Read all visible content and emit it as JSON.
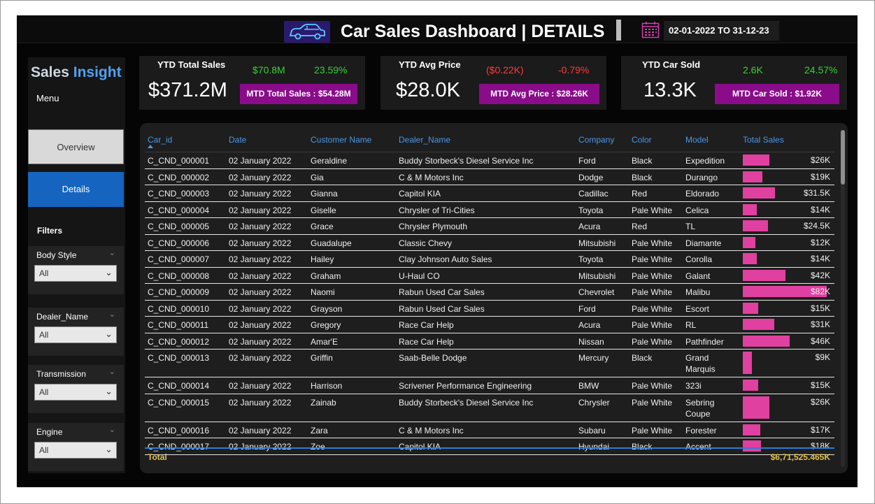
{
  "header": {
    "title": "Car Sales Dashboard | DETAILS",
    "date_range": "02-01-2022 TO 31-12-23"
  },
  "sidebar": {
    "brand_part1": "Sales",
    "brand_part2": "Insight",
    "menu_label": "Menu",
    "nav": [
      {
        "label": "Overview"
      },
      {
        "label": "Details"
      }
    ],
    "filters_label": "Filters",
    "filters": [
      {
        "title": "Body Style",
        "value": "All"
      },
      {
        "title": "Dealer_Name",
        "value": "All"
      },
      {
        "title": "Transmission",
        "value": "All"
      },
      {
        "title": "Engine",
        "value": "All"
      }
    ]
  },
  "kpis": [
    {
      "title": "YTD Total Sales",
      "value": "$371.2M",
      "delta_value": "$70.8M",
      "delta_pct": "23.59%",
      "mtd": "MTD Total Sales : $54.28M"
    },
    {
      "title": "YTD Avg Price",
      "value": "$28.0K",
      "delta_value": "($0.22K)",
      "delta_pct": "-0.79%",
      "mtd": "MTD Avg Price : $28.26K"
    },
    {
      "title": "YTD Car Sold",
      "value": "13.3K",
      "delta_value": "2.6K",
      "delta_pct": "24.57%",
      "mtd": "MTD Car Sold : $1.92K"
    }
  ],
  "table": {
    "columns": [
      "Car_id",
      "Date",
      "Customer Name",
      "Dealer_Name",
      "Company",
      "Color",
      "Model",
      "Total Sales"
    ],
    "rows": [
      {
        "car_id": "C_CND_000001",
        "date": "02 January 2022",
        "customer": "Geraldine",
        "dealer": "Buddy Storbeck's Diesel Service Inc",
        "company": "Ford",
        "color": "Black",
        "model": "Expedition",
        "model2": "",
        "sales": "$26K",
        "sales_value": 26
      },
      {
        "car_id": "C_CND_000002",
        "date": "02 January 2022",
        "customer": "Gia",
        "dealer": "C & M Motors Inc",
        "company": "Dodge",
        "color": "Black",
        "model": "Durango",
        "model2": "",
        "sales": "$19K",
        "sales_value": 19
      },
      {
        "car_id": "C_CND_000003",
        "date": "02 January 2022",
        "customer": "Gianna",
        "dealer": "Capitol KIA",
        "company": "Cadillac",
        "color": "Red",
        "model": "Eldorado",
        "model2": "",
        "sales": "$31.5K",
        "sales_value": 31.5
      },
      {
        "car_id": "C_CND_000004",
        "date": "02 January 2022",
        "customer": "Giselle",
        "dealer": "Chrysler of Tri-Cities",
        "company": "Toyota",
        "color": "Pale White",
        "model": "Celica",
        "model2": "",
        "sales": "$14K",
        "sales_value": 14
      },
      {
        "car_id": "C_CND_000005",
        "date": "02 January 2022",
        "customer": "Grace",
        "dealer": "Chrysler Plymouth",
        "company": "Acura",
        "color": "Red",
        "model": "TL",
        "model2": "",
        "sales": "$24.5K",
        "sales_value": 24.5
      },
      {
        "car_id": "C_CND_000006",
        "date": "02 January 2022",
        "customer": "Guadalupe",
        "dealer": "Classic Chevy",
        "company": "Mitsubishi",
        "color": "Pale White",
        "model": "Diamante",
        "model2": "",
        "sales": "$12K",
        "sales_value": 12
      },
      {
        "car_id": "C_CND_000007",
        "date": "02 January 2022",
        "customer": "Hailey",
        "dealer": "Clay Johnson Auto Sales",
        "company": "Toyota",
        "color": "Pale White",
        "model": "Corolla",
        "model2": "",
        "sales": "$14K",
        "sales_value": 14
      },
      {
        "car_id": "C_CND_000008",
        "date": "02 January 2022",
        "customer": "Graham",
        "dealer": "U-Haul CO",
        "company": "Mitsubishi",
        "color": "Pale White",
        "model": "Galant",
        "model2": "",
        "sales": "$42K",
        "sales_value": 42
      },
      {
        "car_id": "C_CND_000009",
        "date": "02 January 2022",
        "customer": "Naomi",
        "dealer": "Rabun Used Car Sales",
        "company": "Chevrolet",
        "color": "Pale White",
        "model": "Malibu",
        "model2": "",
        "sales": "$82K",
        "sales_value": 82
      },
      {
        "car_id": "C_CND_000010",
        "date": "02 January 2022",
        "customer": "Grayson",
        "dealer": "Rabun Used Car Sales",
        "company": "Ford",
        "color": "Pale White",
        "model": "Escort",
        "model2": "",
        "sales": "$15K",
        "sales_value": 15
      },
      {
        "car_id": "C_CND_000011",
        "date": "02 January 2022",
        "customer": "Gregory",
        "dealer": "Race Car Help",
        "company": "Acura",
        "color": "Pale White",
        "model": "RL",
        "model2": "",
        "sales": "$31K",
        "sales_value": 31
      },
      {
        "car_id": "C_CND_000012",
        "date": "02 January 2022",
        "customer": "Amar'E",
        "dealer": "Race Car Help",
        "company": "Nissan",
        "color": "Pale White",
        "model": "Pathfinder",
        "model2": "",
        "sales": "$46K",
        "sales_value": 46
      },
      {
        "car_id": "C_CND_000013",
        "date": "02 January 2022",
        "customer": "Griffin",
        "dealer": "Saab-Belle Dodge",
        "company": "Mercury",
        "color": "Black",
        "model": "Grand",
        "model2": "Marquis",
        "sales": "$9K",
        "sales_value": 9
      },
      {
        "car_id": "C_CND_000014",
        "date": "02 January 2022",
        "customer": "Harrison",
        "dealer": "Scrivener Performance Engineering",
        "company": "BMW",
        "color": "Pale White",
        "model": "323i",
        "model2": "",
        "sales": "$15K",
        "sales_value": 15
      },
      {
        "car_id": "C_CND_000015",
        "date": "02 January 2022",
        "customer": "Zainab",
        "dealer": "Buddy Storbeck's Diesel Service Inc",
        "company": "Chrysler",
        "color": "Pale White",
        "model": "Sebring",
        "model2": "Coupe",
        "sales": "$26K",
        "sales_value": 26
      },
      {
        "car_id": "C_CND_000016",
        "date": "02 January 2022",
        "customer": "Zara",
        "dealer": "C & M Motors Inc",
        "company": "Subaru",
        "color": "Pale White",
        "model": "Forester",
        "model2": "",
        "sales": "$17K",
        "sales_value": 17
      },
      {
        "car_id": "C_CND_000017",
        "date": "02 January 2022",
        "customer": "Zoe",
        "dealer": "Capitol KIA",
        "company": "Hyundai",
        "color": "Black",
        "model": "Accent",
        "model2": "",
        "sales": "$18K",
        "sales_value": 18
      }
    ],
    "total_label": "Total",
    "total_value": "$6,71,525.465K"
  },
  "colors": {
    "accent_blue": "#4a97e8",
    "nav_active": "#1565c0",
    "mtd_purple": "#8a0c8a",
    "bar_pink": "#e040a0",
    "positive": "#35d335",
    "negative": "#ff3b3b",
    "total_gold": "#e0c050"
  },
  "icons": {
    "logo": "car-icon",
    "date": "calendar-icon",
    "dropdown": "chevron-down-icon"
  }
}
